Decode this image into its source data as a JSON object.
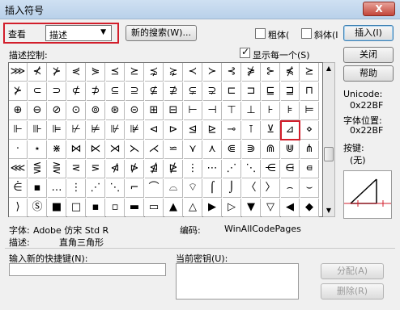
{
  "window": {
    "title": "插入符号",
    "close_label": "X"
  },
  "toolbar": {
    "view_label": "查看",
    "view_value": "描述",
    "search_button": "新的搜索(W)...",
    "bold_label": "粗体(",
    "italic_label": "斜体(I",
    "insert_button": "插入(I)"
  },
  "symbols": {
    "control_label": "描述控制:",
    "show_each_label": "显示每一个(S)",
    "show_each_checked": true,
    "rows": [
      [
        "⋙",
        "⊀",
        "⊁",
        "⋞",
        "⋟",
        "⪯",
        "⪰",
        "⋨",
        "⋩",
        "≺",
        "≻",
        "⊰",
        "⋡",
        "⊱",
        "⋠",
        "⪰"
      ],
      [
        "⊁",
        "⊂",
        "⊃",
        "⊄",
        "⊅",
        "⊆",
        "⊇",
        "⊈",
        "⊉",
        "⊊",
        "⊋",
        "⊏",
        "⊐",
        "⊑",
        "⊒",
        "⊓"
      ],
      [
        "⊕",
        "⊖",
        "⊘",
        "⊙",
        "⊚",
        "⊛",
        "⊝",
        "⊞",
        "⊟",
        "⊢",
        "⊣",
        "⊤",
        "⊥",
        "⊦",
        "⊧",
        "⊨"
      ],
      [
        "⊩",
        "⊪",
        "⊫",
        "⊬",
        "⊭",
        "⊮",
        "⊯",
        "⊲",
        "⊳",
        "⊴",
        "⊵",
        "⊸",
        "⊺",
        "⊻",
        "⊿",
        "⋄"
      ],
      [
        "·",
        "⋆",
        "⋇",
        "⋈",
        "⋉",
        "⋊",
        "⋋",
        "⋌",
        "⋍",
        "⋎",
        "⋏",
        "⋐",
        "⋑",
        "⋒",
        "⋓",
        "⋔"
      ],
      [
        "⋘",
        "⋚",
        "⋛",
        "⋜",
        "⋝",
        "⋪",
        "⋫",
        "⋬",
        "⋭",
        "⋮",
        "⋯",
        "⋰",
        "⋱",
        "⋲",
        "⋳",
        "⋴"
      ],
      [
        "⋵",
        "▪",
        "…",
        "⋮",
        "⋰",
        "⋱",
        "⌐",
        "⌒",
        "⌓",
        "⌔",
        "⌠",
        "⌡",
        "〈",
        "〉",
        "⌢",
        "⌣"
      ],
      [
        "⟩",
        "Ⓢ",
        "■",
        "□",
        "▪",
        "▫",
        "▬",
        "▭",
        "▲",
        "△",
        "▶",
        "▷",
        "▼",
        "▽",
        "◀",
        "◆"
      ]
    ],
    "selected": "⊿"
  },
  "info": {
    "unicode_label": "Unicode:",
    "unicode_value": "0x22BF",
    "charpos_label": "字体位置:",
    "charpos_value": "0x22BF",
    "key_label": "按键:",
    "key_value": "(无)",
    "close_button": "关闭",
    "help_button": "帮助"
  },
  "details": {
    "font_label": "字体:",
    "font_value": "Adobe 仿宋 Std R",
    "encoding_label": "编码:",
    "encoding_value": "WinAllCodePages",
    "description_label": "描述:",
    "description_value": "直角三角形"
  },
  "shortcut": {
    "new_key_label": "输入新的快捷键(N):",
    "current_keys_label": "当前密钥(U):",
    "assign_button": "分配(A)",
    "remove_button": "删除(R)"
  }
}
